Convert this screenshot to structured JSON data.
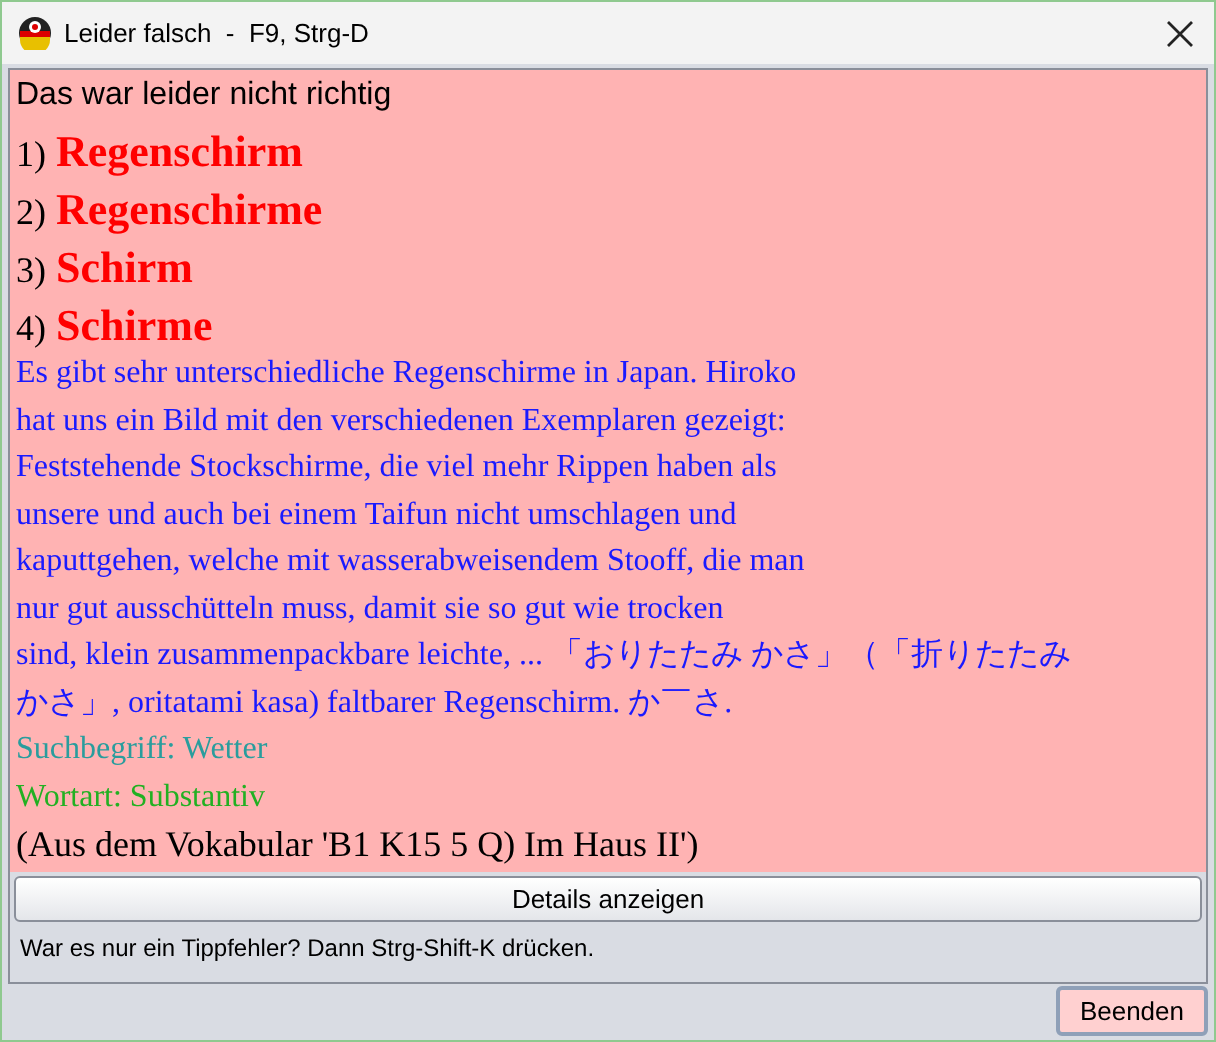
{
  "window": {
    "title": "Leider falsch  -  F9, Strg-D"
  },
  "message": "Das war leider nicht richtig",
  "answers": [
    {
      "number": "1)",
      "word": "Regenschirm"
    },
    {
      "number": "2)",
      "word": "Regenschirme"
    },
    {
      "number": "3)",
      "word": "Schirm"
    },
    {
      "number": "4)",
      "word": "Schirme"
    }
  ],
  "explanation_lines": [
    "Es gibt sehr unterschiedliche Regenschirme in Japan. Hiroko",
    "hat uns ein Bild mit den verschiedenen Exemplaren gezeigt:",
    "Feststehende Stockschirme, die viel mehr Rippen haben als",
    "unsere und auch bei einem Taifun nicht umschlagen und",
    "kaputtgehen, welche mit wasserabweisendem Stooff, die man",
    "nur gut ausschütteln muss, damit sie so gut wie trocken",
    "sind, klein zusammenpackbare leichte, ... 「おりたたみ かさ」（「折りたたみ",
    "かさ」, oritatami kasa) faltbarer Regenschirm. か￣さ."
  ],
  "search_term": "Suchbegriff: Wetter",
  "word_type": "Wortart: Substantiv",
  "source": "(Aus dem Vokabular 'B1 K15 5 Q) Im Haus II')",
  "details_button": "Details anzeigen",
  "hint": "War es nur ein Tippfehler? Dann Strg-Shift-K drücken.",
  "close_button": "Beenden"
}
